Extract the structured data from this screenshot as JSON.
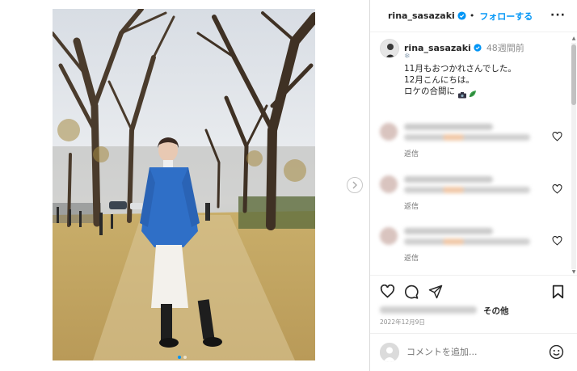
{
  "post": {
    "username": "rina_sasazaki",
    "follow_label": "フォローする",
    "separator": "•",
    "more_label": "···"
  },
  "caption": {
    "username": "rina_sasazaki",
    "timestamp": "48週間前",
    "text": "11月もおつかれさんでした。\n12月こんにちは。\nロケの合間に"
  },
  "comments": [
    {
      "reply_label": "返信"
    },
    {
      "reply_label": "返信"
    },
    {
      "reply_label": "返信"
    }
  ],
  "likes": {
    "others_label": "その他"
  },
  "date": "2022年12月9日",
  "comment_input": {
    "placeholder": "コメントを追加..."
  },
  "icons": {
    "verified": "verified-badge-icon",
    "heart": "heart-icon",
    "comment": "comment-icon",
    "share": "paper-plane-icon",
    "save": "bookmark-icon",
    "emoji": "smiley-icon",
    "next": "chevron-right-icon"
  },
  "colors": {
    "accent": "#0095f6",
    "text": "#262626",
    "muted": "#8e8e8e"
  }
}
